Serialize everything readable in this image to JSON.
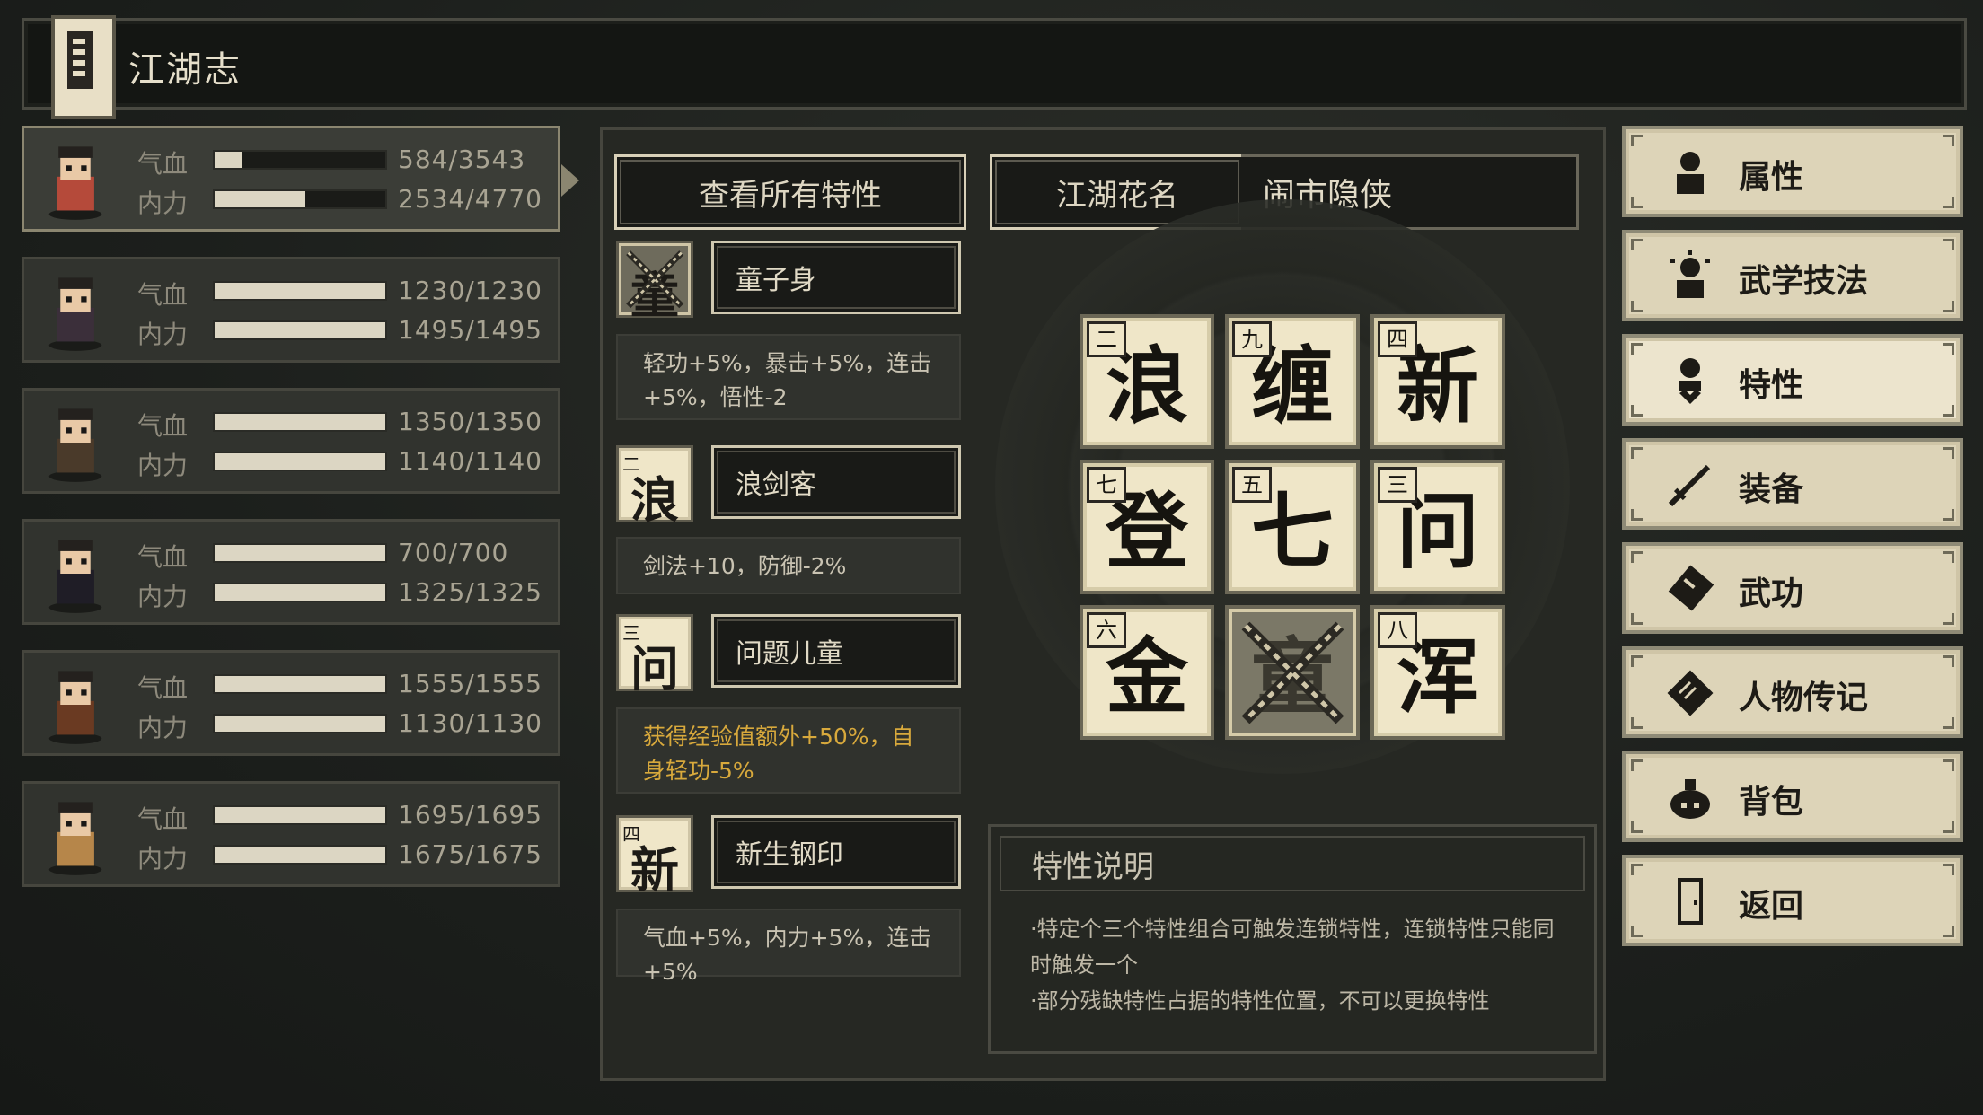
{
  "header": {
    "title": "江湖志"
  },
  "party": [
    {
      "hp_label": "气血",
      "mp_label": "内力",
      "hp": "584/3543",
      "mp": "2534/4770",
      "hp_ratio": 0.165,
      "mp_ratio": 0.531,
      "selected": true
    },
    {
      "hp_label": "气血",
      "mp_label": "内力",
      "hp": "1230/1230",
      "mp": "1495/1495",
      "hp_ratio": 1,
      "mp_ratio": 1
    },
    {
      "hp_label": "气血",
      "mp_label": "内力",
      "hp": "1350/1350",
      "mp": "1140/1140",
      "hp_ratio": 1,
      "mp_ratio": 1
    },
    {
      "hp_label": "气血",
      "mp_label": "内力",
      "hp": "700/700",
      "mp": "1325/1325",
      "hp_ratio": 1,
      "mp_ratio": 1
    },
    {
      "hp_label": "气血",
      "mp_label": "内力",
      "hp": "1555/1555",
      "mp": "1130/1130",
      "hp_ratio": 1,
      "mp_ratio": 1
    },
    {
      "hp_label": "气血",
      "mp_label": "内力",
      "hp": "1695/1695",
      "mp": "1675/1675",
      "hp_ratio": 1,
      "mp_ratio": 1
    }
  ],
  "traits_panel": {
    "view_all_button": "查看所有特性",
    "traits": [
      {
        "tile": "童",
        "num": "",
        "name": "童子身",
        "desc": "轻功+5%，暴击+5%，连击+5%，悟性-2",
        "broken": true
      },
      {
        "tile": "浪",
        "num": "二",
        "name": "浪剑客",
        "desc": "剑法+10，防御-2%"
      },
      {
        "tile": "问",
        "num": "三",
        "name": "问题儿童",
        "desc": "获得经验值额外+50%，自身轻功-5%",
        "highlight": true
      },
      {
        "tile": "新",
        "num": "四",
        "name": "新生钢印",
        "desc": "气血+5%，内力+5%，连击+5%"
      }
    ]
  },
  "nickname": {
    "label": "江湖花名",
    "value": "闹市隐侠"
  },
  "grid": [
    {
      "num": "二",
      "char": "浪"
    },
    {
      "num": "九",
      "char": "缠"
    },
    {
      "num": "四",
      "char": "新"
    },
    {
      "num": "七",
      "char": "登"
    },
    {
      "num": "五",
      "char": "七"
    },
    {
      "num": "三",
      "char": "问"
    },
    {
      "num": "六",
      "char": "金"
    },
    {
      "num": "",
      "char": "童",
      "broken": true
    },
    {
      "num": "八",
      "char": "浑"
    }
  ],
  "explain": {
    "title": "特性说明",
    "lines": [
      "·特定个三个特性组合可触发连锁特性，连锁特性只能同时触发一个",
      "·部分残缺特性占据的特性位置，不可以更换特性"
    ]
  },
  "menu": [
    {
      "label": "属性",
      "icon": "person-icon"
    },
    {
      "label": "武学技法",
      "icon": "spark-person-icon"
    },
    {
      "label": "特性",
      "icon": "heart-person-icon",
      "active": true
    },
    {
      "label": "装备",
      "icon": "sword-icon"
    },
    {
      "label": "武功",
      "icon": "scroll-icon"
    },
    {
      "label": "人物传记",
      "icon": "book-icon"
    },
    {
      "label": "背包",
      "icon": "bag-icon"
    },
    {
      "label": "返回",
      "icon": "door-icon"
    }
  ],
  "colors": {
    "accent_gold": "#d8a93c",
    "tile_bg": "#efe6c8",
    "menu_bg": "#ddd4b8"
  }
}
